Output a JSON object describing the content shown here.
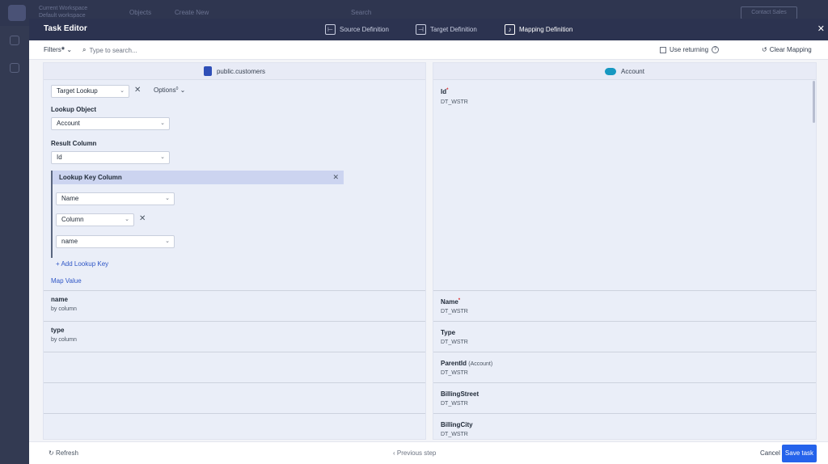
{
  "background": {
    "workspace_label": "Current Workspace",
    "workspace_name": "Default workspace",
    "objects": "Objects",
    "create_new": "Create New",
    "search": "Search",
    "contact_sales": "Contact Sales"
  },
  "modal": {
    "title": "Task Editor",
    "steps": [
      "Source Definition",
      "Target Definition",
      "Mapping Definition"
    ],
    "active_step": "Mapping Definition"
  },
  "toolbar": {
    "filters_label": "Filters",
    "search_placeholder": "Type to search...",
    "use_returning": "Use returning",
    "clear_mapping": "Clear Mapping"
  },
  "left": {
    "title": "public.customers",
    "mapping_type": "Target Lookup",
    "options_label": "Options",
    "options_count": "0",
    "lookup_object_label": "Lookup Object",
    "lookup_object": "Account",
    "result_column_label": "Result Column",
    "result_column": "Id",
    "lookup_key_column": "Lookup Key Column",
    "key_target": "Name",
    "key_kind": "Column",
    "key_source": "name",
    "add_lookup_key": "Add Lookup Key",
    "map_value": "Map Value",
    "fields": [
      {
        "name": "name",
        "sub": "by column"
      },
      {
        "name": "type",
        "sub": "by column"
      }
    ]
  },
  "right": {
    "title": "Account",
    "fields": [
      {
        "name": "Id",
        "required": "*",
        "extra": "",
        "type": "DT_WSTR"
      },
      {
        "name": "Name",
        "required": "*",
        "extra": "",
        "type": "DT_WSTR"
      },
      {
        "name": "Type",
        "required": "",
        "extra": "",
        "type": "DT_WSTR"
      },
      {
        "name": "ParentId",
        "required": "",
        "extra": "(Account)",
        "type": "DT_WSTR"
      },
      {
        "name": "BillingStreet",
        "required": "",
        "extra": "",
        "type": "DT_WSTR"
      },
      {
        "name": "BillingCity",
        "required": "",
        "extra": "",
        "type": "DT_WSTR"
      }
    ]
  },
  "footer": {
    "refresh": "Refresh",
    "previous": "Previous step",
    "cancel": "Cancel",
    "save": "Save task"
  }
}
